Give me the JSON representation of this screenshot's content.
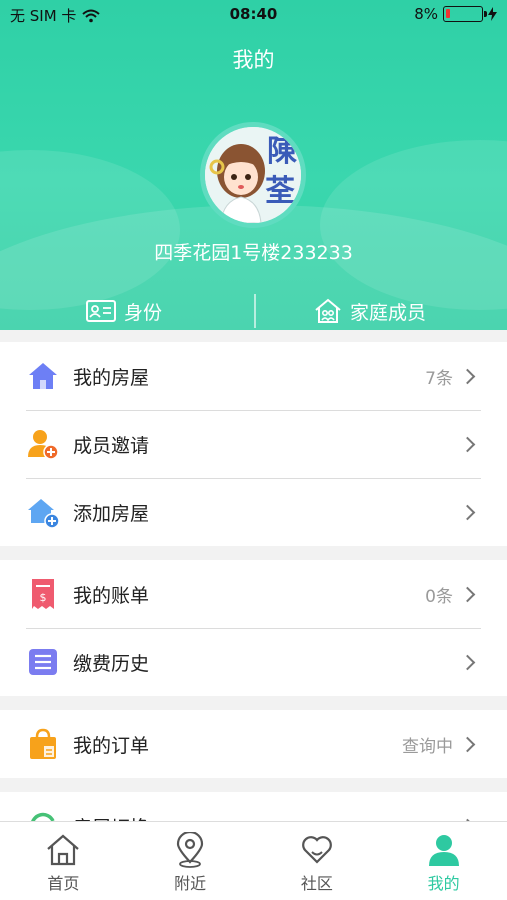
{
  "status_bar": {
    "carrier": "无 SIM 卡",
    "time": "08:40",
    "battery": "8%"
  },
  "header": {
    "title": "我的",
    "address": "四季花园1号楼233233",
    "avatar_text": "陳\n荃"
  },
  "tabs": [
    {
      "label": "身份",
      "icon": "id-card-icon"
    },
    {
      "label": "家庭成员",
      "icon": "house-family-icon"
    }
  ],
  "menu": [
    {
      "label": "我的房屋",
      "value": "7条",
      "icon": "house-icon",
      "color": "#6d7ff5"
    },
    {
      "label": "成员邀请",
      "value": "",
      "icon": "user-add-icon",
      "color": "#f7a21b"
    },
    {
      "label": "添加房屋",
      "value": "",
      "icon": "house-add-icon",
      "color": "#5ea6f2"
    },
    {
      "label": "我的账单",
      "value": "0条",
      "icon": "bill-icon",
      "color": "#ef5b6f"
    },
    {
      "label": "缴费历史",
      "value": "",
      "icon": "list-icon",
      "color": "#7b7cf0"
    },
    {
      "label": "我的订单",
      "value": "查询中",
      "icon": "shopping-bag-icon",
      "color": "#f7a21b"
    },
    {
      "label": "房屋切换",
      "value": "",
      "icon": "switch-icon",
      "color": "#46c176"
    }
  ],
  "tabbar": [
    {
      "label": "首页",
      "icon": "home-icon"
    },
    {
      "label": "附近",
      "icon": "location-pin-icon"
    },
    {
      "label": "社区",
      "icon": "heart-chat-icon"
    },
    {
      "label": "我的",
      "icon": "person-icon",
      "active": true
    }
  ],
  "colors": {
    "accent": "#2ec9a1",
    "header_bg": "#36d3a8"
  }
}
